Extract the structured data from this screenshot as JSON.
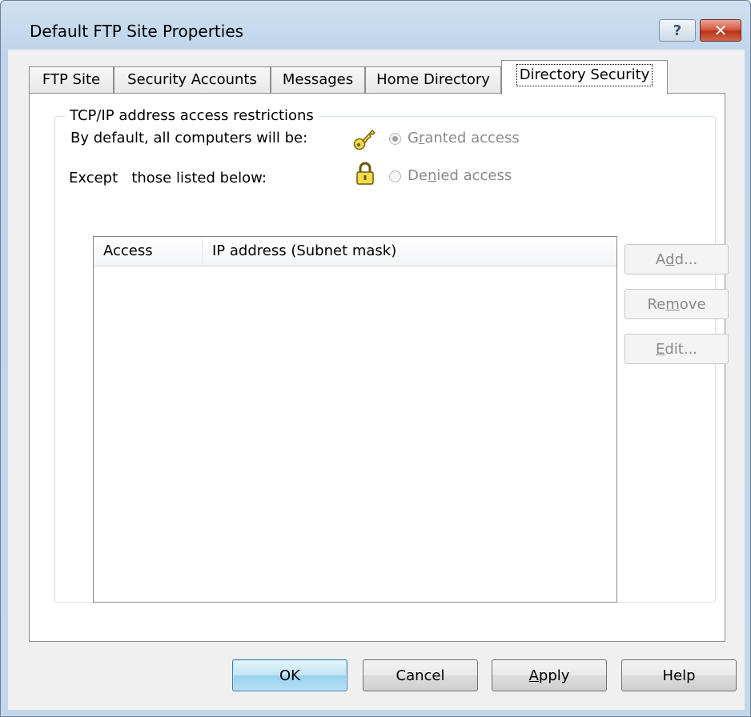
{
  "window": {
    "title": "Default FTP Site Properties",
    "help_button_label": "?",
    "close_button_label": "✕"
  },
  "tabs": [
    {
      "label": "FTP Site"
    },
    {
      "label": "Security Accounts"
    },
    {
      "label": "Messages"
    },
    {
      "label": "Home Directory"
    },
    {
      "label": "Directory Security",
      "active": true
    }
  ],
  "group": {
    "legend": "TCP/IP address access restrictions",
    "default_label": "By default, all computers will be:",
    "except_label": "Except   those listed below:",
    "granted": {
      "pre": "G",
      "accel": "r",
      "post": "anted access",
      "icon": "key-icon",
      "selected": true
    },
    "denied": {
      "pre": "De",
      "accel": "n",
      "post": "ied access",
      "icon": "lock-icon",
      "selected": false
    }
  },
  "list": {
    "columns": [
      "Access",
      "IP address (Subnet mask)"
    ],
    "rows": []
  },
  "side_buttons": {
    "add": {
      "pre": "A",
      "accel": "d",
      "post": "d..."
    },
    "remove": {
      "pre": "Re",
      "accel": "m",
      "post": "ove"
    },
    "edit": {
      "pre": "",
      "accel": "E",
      "post": "dit..."
    }
  },
  "bottom_buttons": {
    "ok": "OK",
    "cancel": "Cancel",
    "apply": {
      "pre": "",
      "accel": "A",
      "post": "pply"
    },
    "help": "Help"
  },
  "colors": {
    "title_bar": "#c8dcf0",
    "close_button": "#c83c22",
    "default_button_border": "#3c7fb1",
    "disabled_text": "#8a8a8a"
  }
}
